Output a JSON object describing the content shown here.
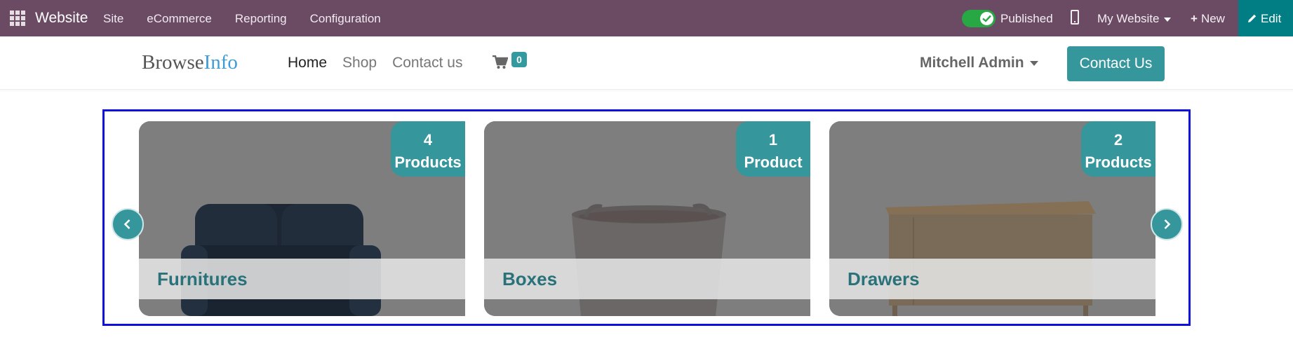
{
  "adminbar": {
    "app_title": "Website",
    "menu": [
      "Site",
      "eCommerce",
      "Reporting",
      "Configuration"
    ],
    "published_label": "Published",
    "published_on": true,
    "website_switcher": "My Website",
    "new_label": "New",
    "edit_label": "Edit",
    "icons": [
      "apps-grid-icon",
      "check-icon",
      "mobile-preview-icon",
      "plus-icon",
      "pencil-icon"
    ]
  },
  "header": {
    "logo_part1": "Browse",
    "logo_part2": "Info",
    "nav": [
      "Home",
      "Shop",
      "Contact us"
    ],
    "cart_count": "0",
    "user_name": "Mitchell Admin",
    "contact_button": "Contact Us"
  },
  "carousel": {
    "categories": [
      {
        "name": "Furnitures",
        "count": "4",
        "unit": "Products",
        "image": "sofa"
      },
      {
        "name": "Boxes",
        "count": "1",
        "unit": "Product",
        "image": "storage-basket"
      },
      {
        "name": "Drawers",
        "count": "2",
        "unit": "Products",
        "image": "drawer-cabinet"
      }
    ],
    "colors": {
      "accent": "#35969c",
      "label": "#29727a",
      "outline": "#1010dd"
    }
  }
}
